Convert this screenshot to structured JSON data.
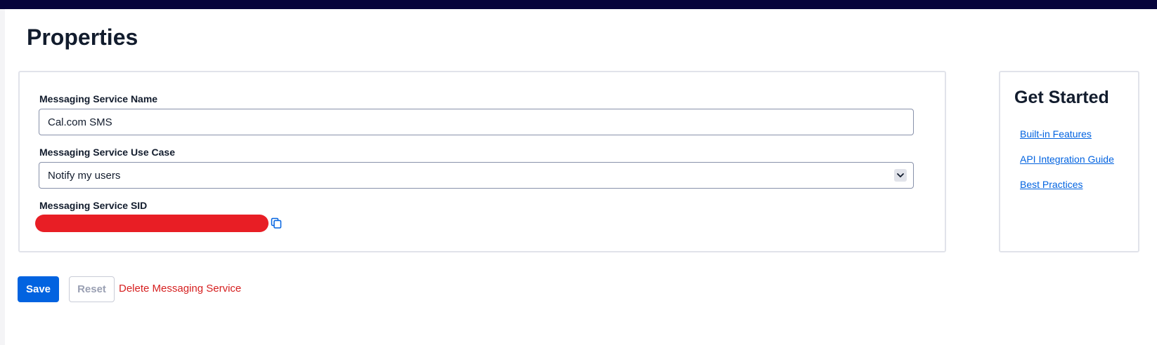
{
  "page": {
    "title": "Properties"
  },
  "form": {
    "name_label": "Messaging Service Name",
    "name_value": "Cal.com SMS",
    "use_case_label": "Messaging Service Use Case",
    "use_case_value": "Notify my users",
    "sid_label": "Messaging Service SID"
  },
  "sidebar": {
    "title": "Get Started",
    "links": [
      {
        "label": "Built-in Features"
      },
      {
        "label": "API Integration Guide"
      },
      {
        "label": "Best Practices"
      }
    ]
  },
  "actions": {
    "save_label": "Save",
    "reset_label": "Reset",
    "delete_label": "Delete Messaging Service"
  },
  "icons": {
    "copy": "copy-icon",
    "chevron": "chevron-down-icon"
  },
  "colors": {
    "topbar": "#06033a",
    "primary": "#0263e0",
    "danger": "#d61f1f",
    "redaction": "#e81e25"
  }
}
